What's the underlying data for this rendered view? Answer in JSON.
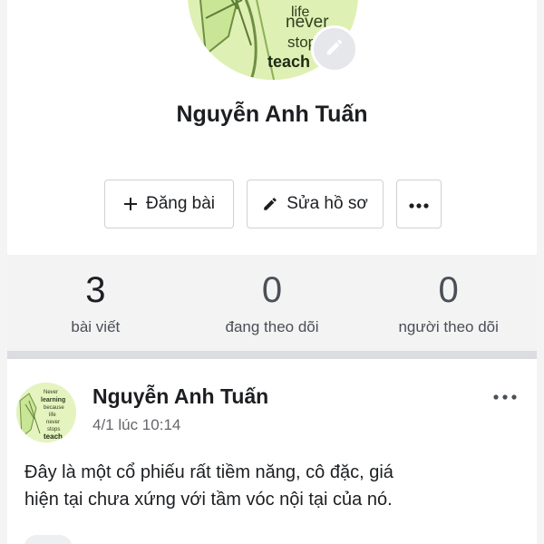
{
  "profile": {
    "name": "Nguyễn Anh Tuấn",
    "avatar_words": [
      "life",
      "never",
      "stop",
      "teach"
    ],
    "edit_avatar_icon": "pencil-icon"
  },
  "actions": {
    "post_label": "Đăng bài",
    "post_icon": "plus-icon",
    "edit_label": "Sửa hồ sơ",
    "edit_icon": "pencil-icon",
    "more_icon": "more-dots-icon"
  },
  "stats": {
    "posts": {
      "value": "3",
      "label": "bài viết"
    },
    "following": {
      "value": "0",
      "label": "đang theo dõi"
    },
    "followers": {
      "value": "0",
      "label": "người theo dõi"
    }
  },
  "post": {
    "author": "Nguyễn Anh Tuấn",
    "time": "4/1 lúc 10:14",
    "text_line1": "Đây là một cổ phiếu rất tiềm năng, cô đặc, giá",
    "text_line2": "hiện tại chưa xứng với tầm vóc nội tại của nó.",
    "avatar_words": [
      "Never",
      "learning",
      "because",
      "life",
      "never",
      "stops",
      "teach"
    ],
    "more_icon": "more-dots-icon"
  },
  "colors": {
    "stats_bg": "#f3f3f4",
    "divider": "#dcdde0",
    "secondary_text": "#65676b",
    "avatar_bg": "#dff0b4"
  }
}
